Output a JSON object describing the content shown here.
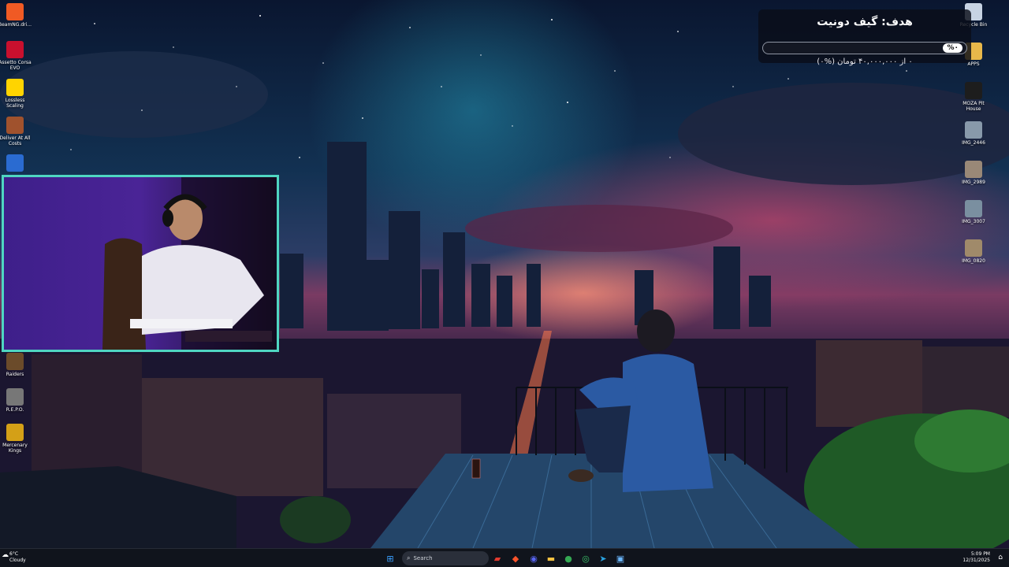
{
  "desktop_left": [
    {
      "label": "BeamNG.dri...",
      "icon": "beamng-icon",
      "color": "#f05a24"
    },
    {
      "label": "Assetto Corsa EVO",
      "icon": "assetto-corsa-icon",
      "color": "#c8102e"
    },
    {
      "label": "Lossless Scaling",
      "icon": "lossless-scaling-icon",
      "color": "#ffd400"
    },
    {
      "label": "Deliver At All Costs",
      "icon": "deliver-at-all-costs-icon",
      "color": "#a0522d"
    },
    {
      "label": "",
      "icon": "game-shortcut-icon",
      "color": "#2a6bd1"
    }
  ],
  "desktop_left_lower": [
    {
      "label": "Raiders",
      "icon": "raiders-icon",
      "color": "#6b4b2a"
    },
    {
      "label": "R.E.P.O.",
      "icon": "repo-icon",
      "color": "#777777"
    },
    {
      "label": "Mercenary Kings",
      "icon": "mercenary-kings-icon",
      "color": "#d4a017"
    }
  ],
  "desktop_right": [
    {
      "label": "Recycle Bin",
      "icon": "recycle-bin-icon",
      "color": "#c7d3e3"
    },
    {
      "label": "APPS",
      "icon": "folder-icon",
      "color": "#e8b84a"
    },
    {
      "label": "MOZA Pit House",
      "icon": "moza-icon",
      "color": "#1d1d1d"
    },
    {
      "label": "IMG_2446",
      "icon": "image-file-icon",
      "color": "#8899aa"
    },
    {
      "label": "IMG_2989",
      "icon": "image-file-icon",
      "color": "#998877"
    },
    {
      "label": "IMG_3007",
      "icon": "image-file-icon",
      "color": "#7a8fa0"
    },
    {
      "label": "IMG_0820",
      "icon": "image-file-icon",
      "color": "#a08a6a"
    }
  ],
  "goal": {
    "title": "هدف: گیف دونیت",
    "percent_label": "%۰",
    "progress": 0,
    "subtitle": "۰ از ۴۰,۰۰۰,۰۰۰ تومان (%۰)"
  },
  "taskbar": {
    "weather_temp": "6°C",
    "weather_desc": "Cloudy",
    "search_placeholder": "Search",
    "time": "5:09 PM",
    "date": "12/31/2025",
    "apps": [
      {
        "icon": "windows-start-icon",
        "glyph": "⊞",
        "color": "#3aa0ff"
      },
      {
        "icon": "red-app-icon",
        "glyph": "▰",
        "color": "#e03a2f"
      },
      {
        "icon": "brave-browser-icon",
        "glyph": "◆",
        "color": "#fb542b"
      },
      {
        "icon": "discord-icon",
        "glyph": "◉",
        "color": "#5865f2"
      },
      {
        "icon": "file-explorer-icon",
        "glyph": "▬",
        "color": "#f5c242"
      },
      {
        "icon": "chrome-icon",
        "glyph": "●",
        "color": "#34a853"
      },
      {
        "icon": "xbox-icon",
        "glyph": "◎",
        "color": "#3cc46a"
      },
      {
        "icon": "telegram-icon",
        "glyph": "➤",
        "color": "#2aa3e0"
      },
      {
        "icon": "desktop-app-icon",
        "glyph": "▣",
        "color": "#6bb7ff"
      }
    ]
  }
}
